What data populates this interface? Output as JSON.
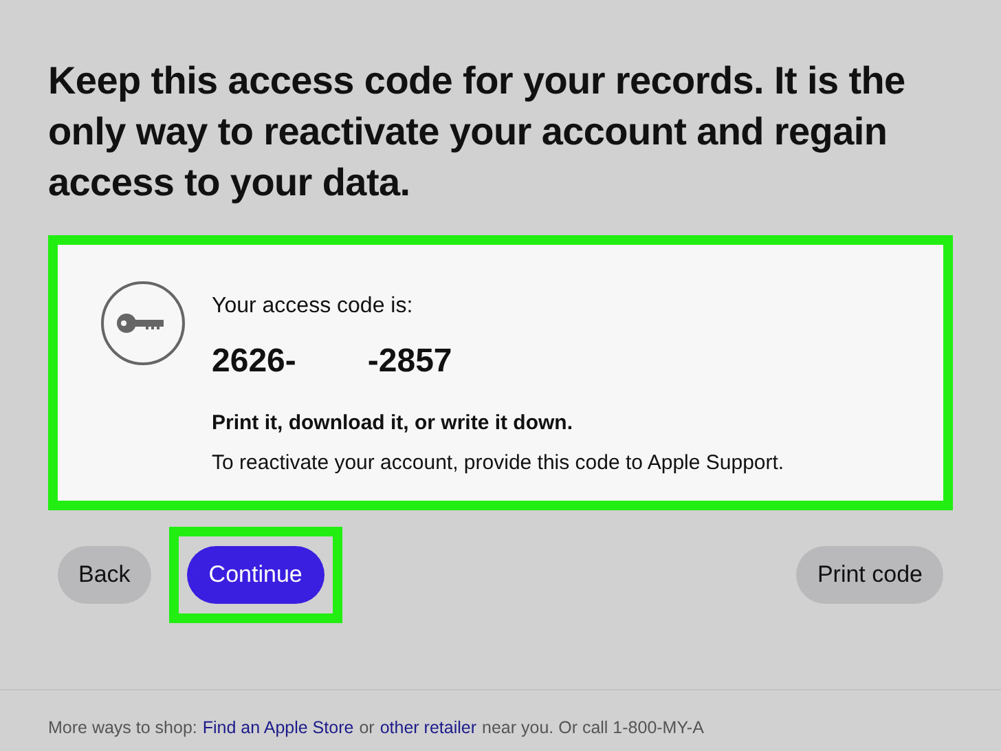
{
  "heading": "Keep this access code for your records. It is the only way to reactivate your account and regain access to your data.",
  "code_card": {
    "highlighted": true,
    "label": "Your access code is:",
    "code_parts": [
      "2626-",
      "-2857"
    ],
    "instruction": "Print it, download it, or write it down.",
    "note": "To reactivate your account, provide this code to Apple Support."
  },
  "buttons": [
    {
      "label": "Back",
      "kind": "secondary",
      "highlighted": false
    },
    {
      "label": "Continue",
      "kind": "primary",
      "highlighted": true
    },
    {
      "label": "Print code",
      "kind": "secondary",
      "highlighted": false
    }
  ],
  "footer": [
    {
      "kind": "text",
      "text": "More ways to shop:"
    },
    {
      "kind": "link",
      "text": "Find an Apple Store"
    },
    {
      "kind": "text",
      "text": "or"
    },
    {
      "kind": "link",
      "text": "other retailer"
    },
    {
      "kind": "text",
      "text": "near you. Or call 1-800-MY-A"
    }
  ]
}
